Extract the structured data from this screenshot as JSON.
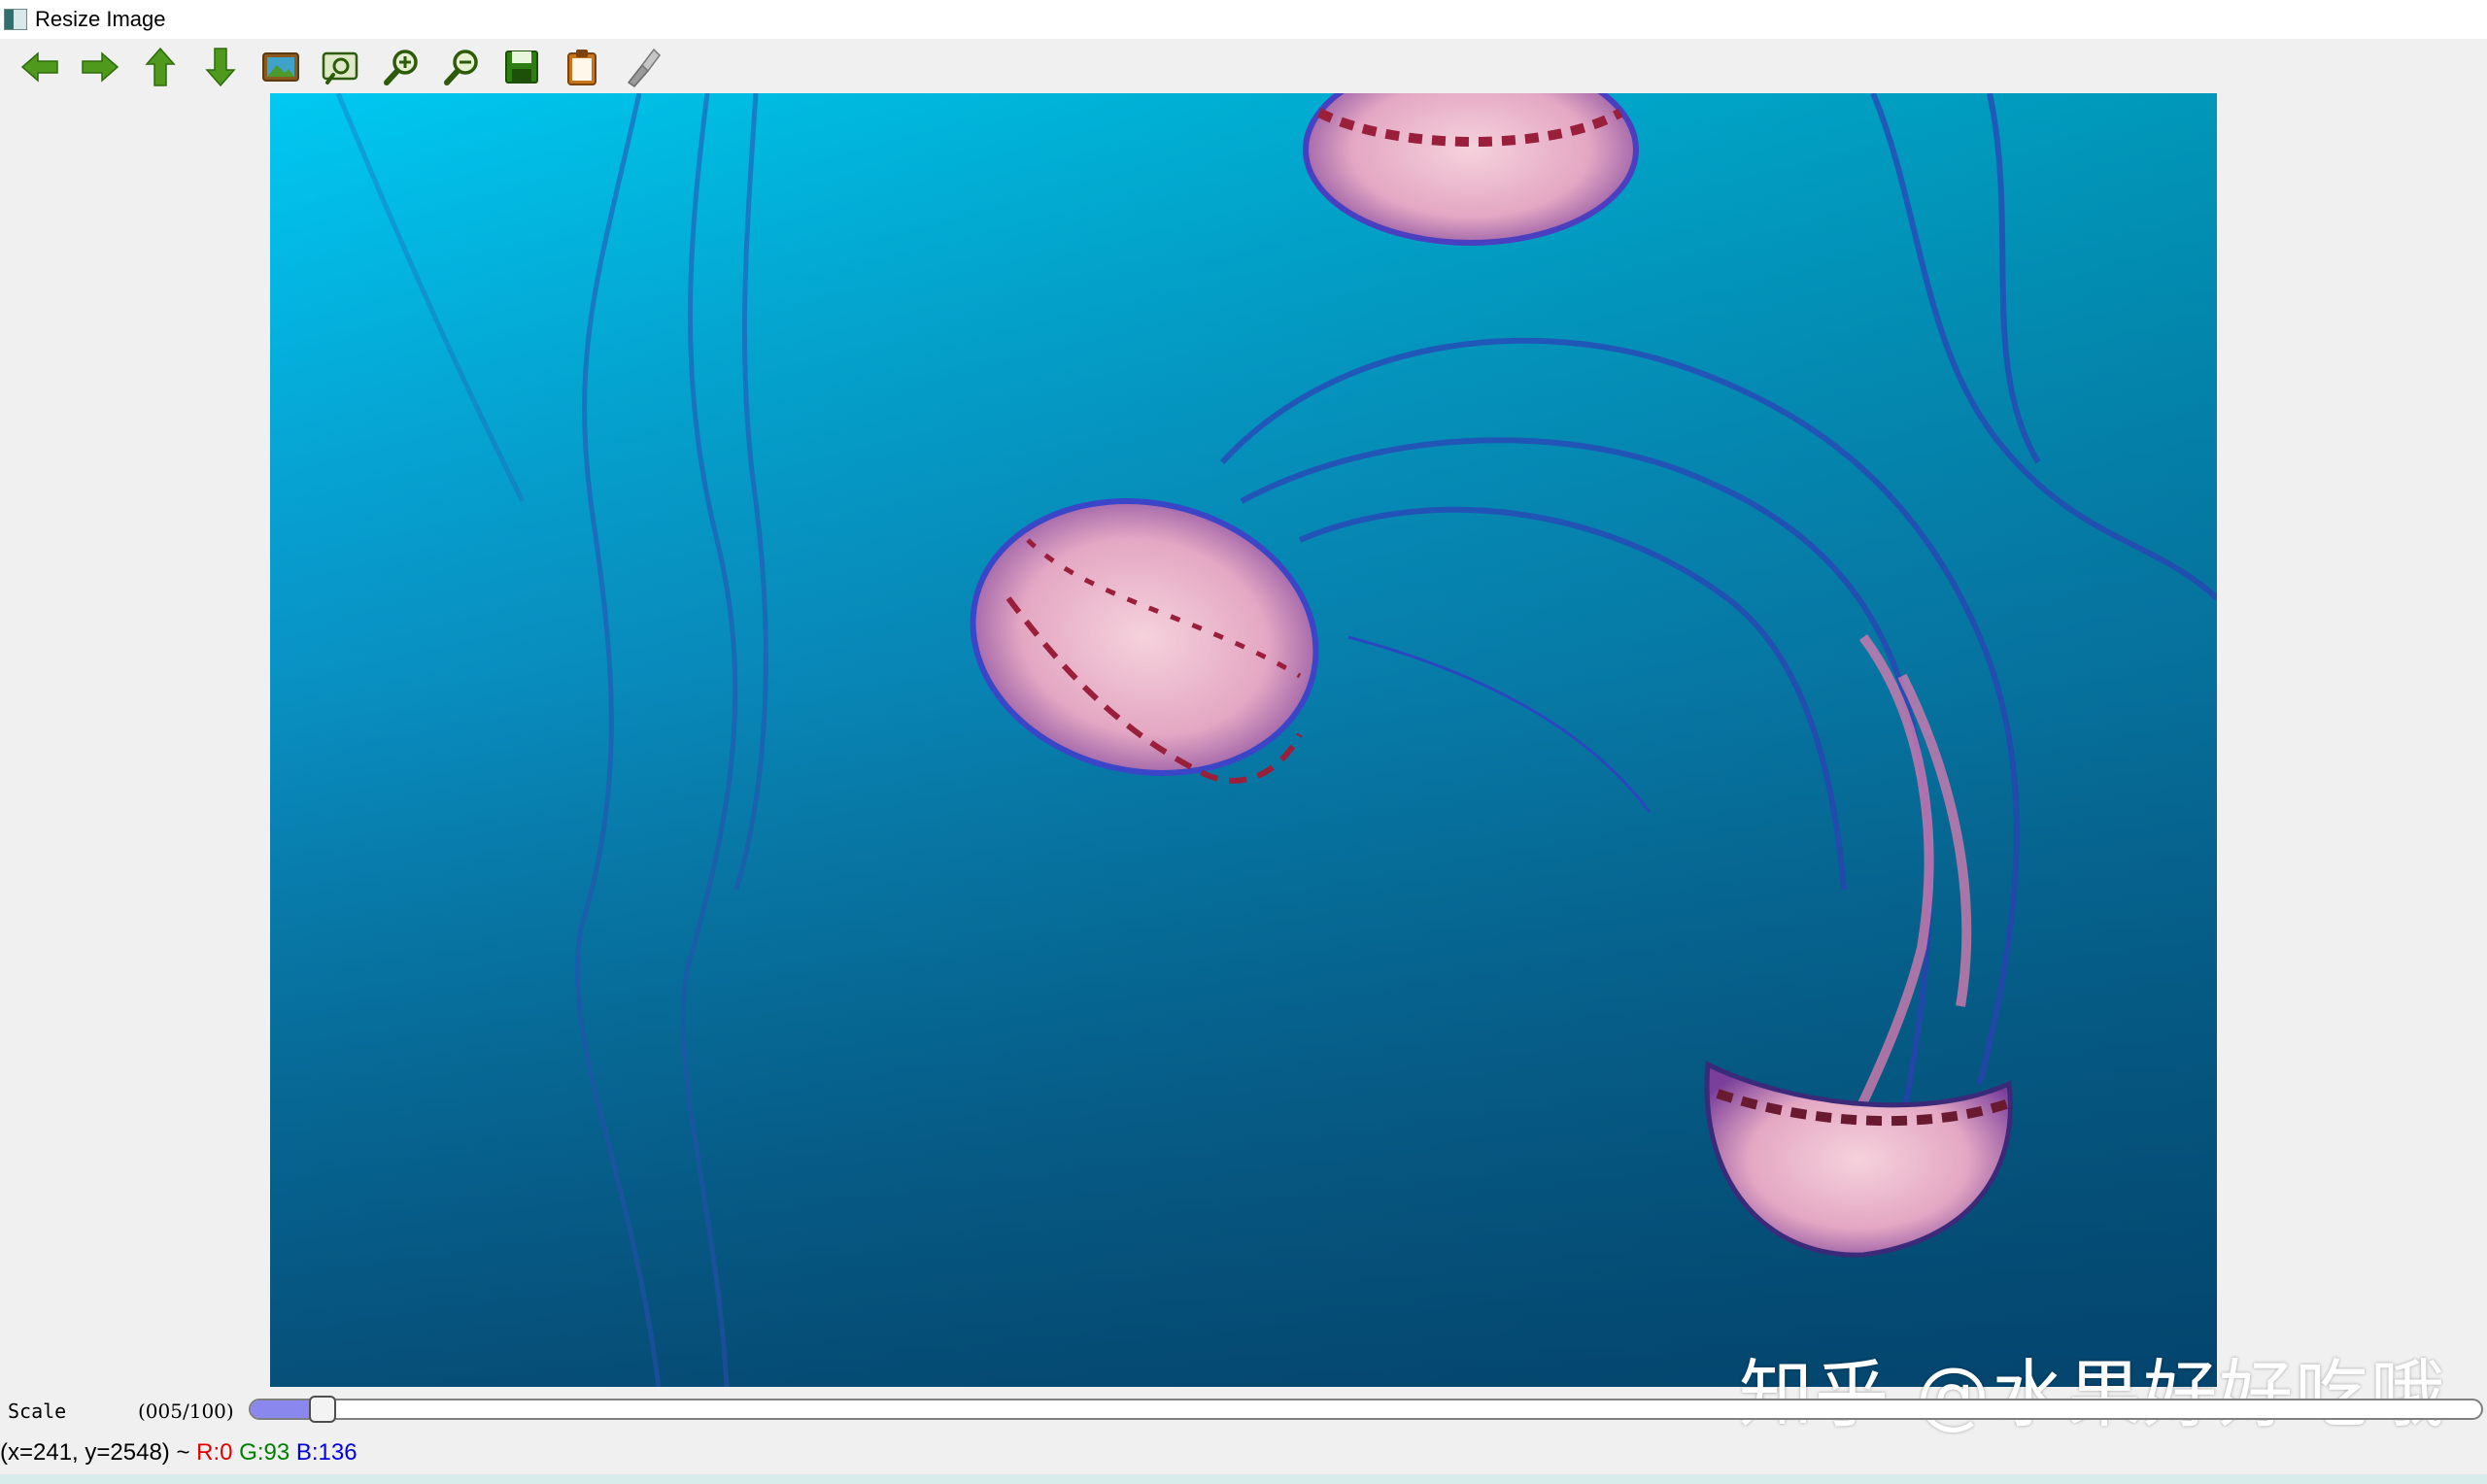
{
  "window": {
    "title": "Resize Image"
  },
  "toolbar": {
    "buttons": [
      {
        "name": "pan-left-button",
        "icon": "arrow-left-icon",
        "color": "#4f9a1d"
      },
      {
        "name": "pan-right-button",
        "icon": "arrow-right-icon",
        "color": "#4f9a1d"
      },
      {
        "name": "pan-up-button",
        "icon": "arrow-up-icon",
        "color": "#4f9a1d"
      },
      {
        "name": "pan-down-button",
        "icon": "arrow-down-icon",
        "color": "#4f9a1d"
      },
      {
        "name": "zoom-original-button",
        "icon": "image-icon"
      },
      {
        "name": "zoom-fit-button",
        "icon": "zoom-fit-icon"
      },
      {
        "name": "zoom-in-button",
        "icon": "zoom-in-icon"
      },
      {
        "name": "zoom-out-button",
        "icon": "zoom-out-icon"
      },
      {
        "name": "save-button",
        "icon": "save-icon"
      },
      {
        "name": "copy-button",
        "icon": "clipboard-icon"
      },
      {
        "name": "properties-button",
        "icon": "properties-icon"
      }
    ]
  },
  "trackbar": {
    "label": "Scale",
    "value_text": "(005/100)",
    "value": 5,
    "max": 100,
    "fill_color": "#8a87ee"
  },
  "status": {
    "coords": "(x=241, y=2548) ~ ",
    "r": "R:0",
    "g": "G:93",
    "b": "B:136",
    "r_color": "#e00000",
    "g_color": "#008000",
    "b_color": "#0000e0"
  },
  "watermark": {
    "text": "知乎 @水果好好吃哦"
  },
  "image": {
    "subject": "jellyfish-underwater"
  }
}
